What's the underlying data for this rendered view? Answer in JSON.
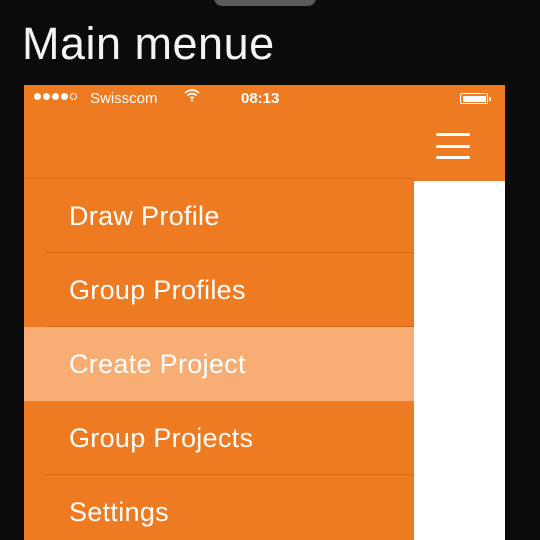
{
  "heading": "Main menue",
  "status_bar": {
    "signal_icon": "signal-dots-icon",
    "carrier": "Swisscom",
    "wifi_icon": "wifi-icon",
    "time": "08:13",
    "battery_icon": "battery-icon"
  },
  "header": {
    "menu_icon": "hamburger-menu-icon"
  },
  "menu": {
    "items": [
      {
        "label": "Draw Profile",
        "active": false
      },
      {
        "label": "Group Profiles",
        "active": false
      },
      {
        "label": "Create Project",
        "active": true
      },
      {
        "label": "Group Projects",
        "active": false
      },
      {
        "label": "Settings",
        "active": false
      }
    ]
  },
  "colors": {
    "accent": "#ee7a22",
    "active_item": "#f7ad73",
    "background": "#0b0b0b",
    "text": "#ffffff"
  }
}
